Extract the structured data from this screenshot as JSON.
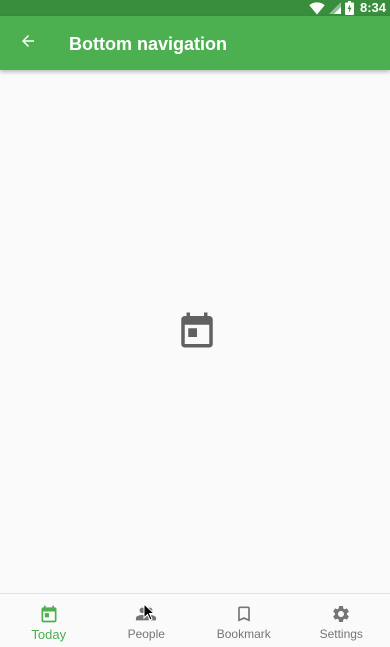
{
  "status_bar": {
    "time": "8:34",
    "icons": [
      "wifi-icon",
      "signal-icon",
      "battery-icon"
    ]
  },
  "app_bar": {
    "title": "Bottom navigation",
    "back_icon": "arrow-back-icon",
    "color": "#4caf50",
    "status_color": "#388e3c"
  },
  "content": {
    "icon": "calendar-today-icon",
    "icon_color": "#616161"
  },
  "bottom_nav": {
    "active_color": "#4caf50",
    "inactive_color": "#757575",
    "items": [
      {
        "label": "Today",
        "icon": "calendar-icon",
        "active": true
      },
      {
        "label": "People",
        "icon": "people-icon",
        "active": false
      },
      {
        "label": "Bookmark",
        "icon": "bookmark-icon",
        "active": false
      },
      {
        "label": "Settings",
        "icon": "settings-gear-icon",
        "active": false
      }
    ]
  }
}
